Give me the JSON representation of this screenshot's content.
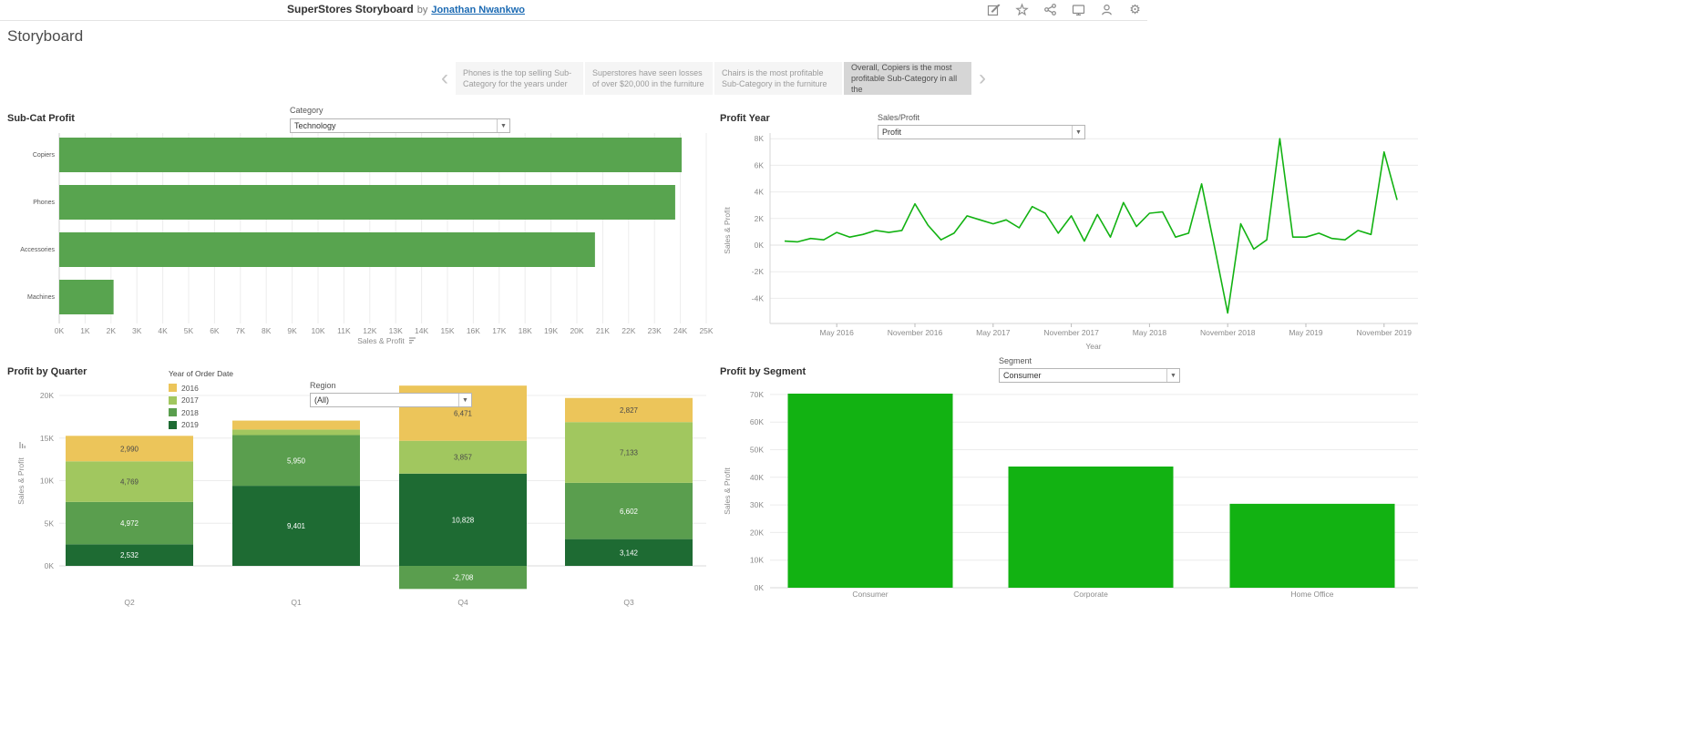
{
  "header": {
    "title": "SuperStores Storyboard",
    "by_text": "by",
    "author": "Jonathan Nwankwo",
    "icons": [
      "edit",
      "favorite",
      "share",
      "display",
      "profile",
      "settings"
    ],
    "accent_color": "#1b6ab3"
  },
  "page_title": "Storyboard",
  "story": {
    "prev_icon": "‹",
    "next_icon": "›",
    "captions": [
      {
        "text": "Phones is the top selling Sub-Category for the years under",
        "active": false
      },
      {
        "text": "Superstores have seen losses of over $20,000 in the furniture",
        "active": false
      },
      {
        "text": "Chairs is the most profitable Sub-Category in the furniture",
        "active": false
      },
      {
        "text": "Overall, Copiers is the most profitable Sub-Category in all the",
        "active": true
      }
    ]
  },
  "chart_data": [
    {
      "id": "sub_cat_profit",
      "type": "bar",
      "orientation": "horizontal",
      "title": "Sub-Cat Profit",
      "categories": [
        "Copiers",
        "Phones",
        "Accessories",
        "Machines"
      ],
      "values": [
        24050,
        23800,
        20700,
        2100
      ],
      "xlabel": "Sales & Profit",
      "xlim": [
        0,
        25000
      ],
      "x_tick_step": 1000,
      "x_ticks": [
        "0K",
        "1K",
        "2K",
        "3K",
        "4K",
        "5K",
        "6K",
        "7K",
        "8K",
        "9K",
        "10K",
        "11K",
        "12K",
        "13K",
        "14K",
        "15K",
        "16K",
        "17K",
        "18K",
        "19K",
        "20K",
        "21K",
        "22K",
        "23K",
        "24K",
        "25K"
      ],
      "bar_color": "#58a44f",
      "grid": true,
      "filter": {
        "label": "Category",
        "value": "Technology"
      }
    },
    {
      "id": "profit_year",
      "type": "line",
      "title": "Profit Year",
      "series_name": "Profit",
      "ylabel": "Sales & Profit",
      "xlabel": "Year",
      "ylim": [
        -5500,
        8500
      ],
      "y_ticks": [
        {
          "label": "8K",
          "value": 8000
        },
        {
          "label": "6K",
          "value": 6000
        },
        {
          "label": "4K",
          "value": 4000
        },
        {
          "label": "2K",
          "value": 2000
        },
        {
          "label": "0K",
          "value": 0
        },
        {
          "label": "-2K",
          "value": -2000
        },
        {
          "label": "-4K",
          "value": -4000
        }
      ],
      "x_ticks": [
        {
          "label": "May 2016",
          "month": 4
        },
        {
          "label": "November 2016",
          "month": 10
        },
        {
          "label": "May 2017",
          "month": 16
        },
        {
          "label": "November 2017",
          "month": 22
        },
        {
          "label": "May 2018",
          "month": 28
        },
        {
          "label": "November 2018",
          "month": 34
        },
        {
          "label": "May 2019",
          "month": 40
        },
        {
          "label": "November 2019",
          "month": 46
        }
      ],
      "x_start": "January 2016",
      "values": [
        300,
        250,
        500,
        400,
        950,
        600,
        800,
        1100,
        950,
        1100,
        3100,
        1500,
        400,
        900,
        2200,
        1900,
        1600,
        1900,
        1300,
        2900,
        2400,
        900,
        2200,
        300,
        2300,
        600,
        3200,
        1400,
        2400,
        2500,
        600,
        900,
        4600,
        -200,
        -5100,
        1600,
        -300,
        400,
        8000,
        600,
        600,
        900,
        500,
        400,
        1100,
        800,
        7000,
        3400
      ],
      "line_color": "#12b212",
      "grid": true,
      "filter": {
        "label": "Sales/Profit",
        "value": "Profit"
      }
    },
    {
      "id": "profit_by_quarter",
      "type": "stacked_bar",
      "title": "Profit by Quarter",
      "legend_title": "Year of Order Date",
      "legend_position": "top-inside",
      "categories": [
        "Q2",
        "Q1",
        "Q4",
        "Q3"
      ],
      "series": [
        {
          "name": "2016",
          "color": "#ecc55a",
          "label_color": "#4a4a4a",
          "values": [
            2990,
            1050,
            6471,
            2827
          ]
        },
        {
          "name": "2017",
          "color": "#a1c75f",
          "label_color": "#4a4a4a",
          "values": [
            4769,
            650,
            3857,
            7133
          ]
        },
        {
          "name": "2018",
          "color": "#5a9e4e",
          "label_color": "#ffffff",
          "values": [
            4972,
            5950,
            -2708,
            6602
          ]
        },
        {
          "name": "2019",
          "color": "#1e6b33",
          "label_color": "#ffffff",
          "values": [
            2532,
            9401,
            10828,
            3142
          ]
        }
      ],
      "stack_order_bottom_to_top": [
        "2019",
        "2018",
        "2017",
        "2016"
      ],
      "label_min": 1500,
      "ylabel": "Sales & Profit",
      "ylim": [
        -3500,
        21500
      ],
      "y_ticks": [
        {
          "label": "0K",
          "value": 0
        },
        {
          "label": "5K",
          "value": 5000
        },
        {
          "label": "10K",
          "value": 10000
        },
        {
          "label": "15K",
          "value": 15000
        },
        {
          "label": "20K",
          "value": 20000
        }
      ],
      "grid": true,
      "filter": {
        "label": "Region",
        "value": "(All)"
      }
    },
    {
      "id": "profit_by_segment",
      "type": "bar",
      "orientation": "vertical",
      "title": "Profit by Segment",
      "categories": [
        "Consumer",
        "Corporate",
        "Home Office"
      ],
      "values": [
        70300,
        43900,
        30400
      ],
      "ylabel": "Sales & Profit",
      "ylim": [
        0,
        72000
      ],
      "y_ticks": [
        {
          "label": "0K",
          "value": 0
        },
        {
          "label": "10K",
          "value": 10000
        },
        {
          "label": "20K",
          "value": 20000
        },
        {
          "label": "30K",
          "value": 30000
        },
        {
          "label": "40K",
          "value": 40000
        },
        {
          "label": "50K",
          "value": 50000
        },
        {
          "label": "60K",
          "value": 60000
        },
        {
          "label": "70K",
          "value": 70000
        }
      ],
      "bar_color": "#12b212",
      "grid": true,
      "filter": {
        "label": "Segment",
        "value": "Consumer"
      }
    }
  ]
}
